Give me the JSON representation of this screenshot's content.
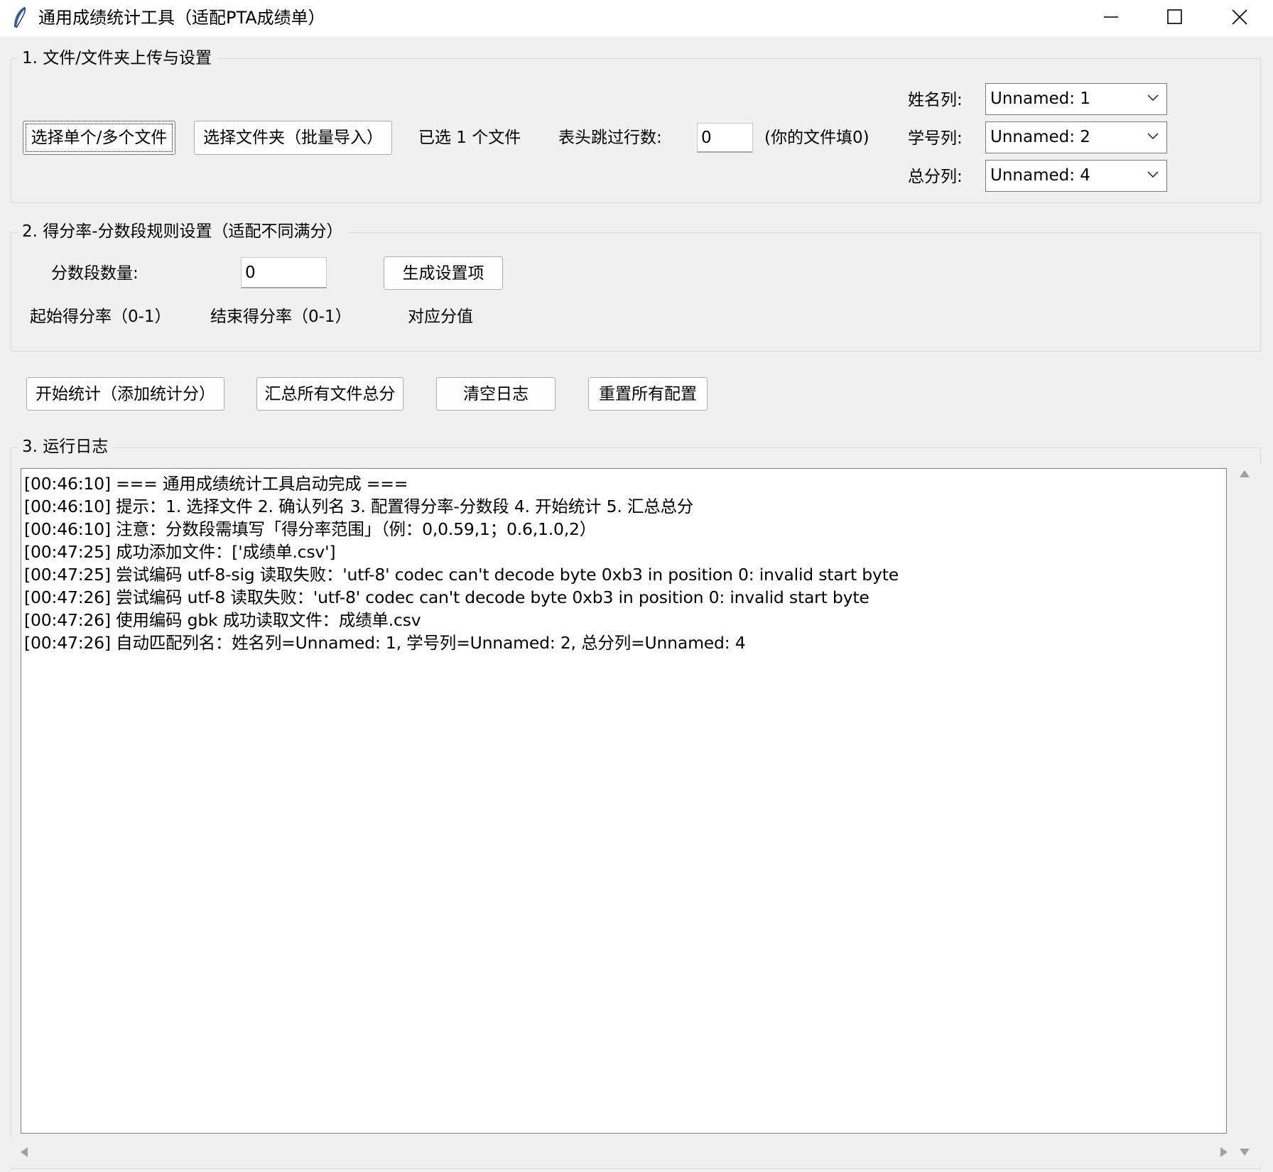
{
  "window": {
    "title": "通用成绩统计工具（适配PTA成绩单）"
  },
  "section1": {
    "label": "1. 文件/文件夹上传与设置",
    "select_files_button": "选择单个/多个文件",
    "select_folder_button": "选择文件夹（批量导入）",
    "selected_count_text": "已选 1 个文件",
    "skip_rows_label": "表头跳过行数:",
    "skip_rows_value": "0",
    "skip_rows_hint": "(你的文件填0)",
    "name_col_label": "姓名列:",
    "name_col_value": "Unnamed: 1",
    "id_col_label": "学号列:",
    "id_col_value": "Unnamed: 2",
    "total_col_label": "总分列:",
    "total_col_value": "Unnamed: 4"
  },
  "section2": {
    "label": "2. 得分率-分数段规则设置（适配不同满分）",
    "segment_count_label": "分数段数量:",
    "segment_count_value": "0",
    "generate_button": "生成设置项",
    "col_start": "起始得分率（0-1）",
    "col_end": "结束得分率（0-1）",
    "col_score": "对应分值"
  },
  "actions": {
    "start_button": "开始统计（添加统计分）",
    "summary_button": "汇总所有文件总分",
    "clear_log_button": "清空日志",
    "reset_button": "重置所有配置"
  },
  "section3": {
    "label": "3. 运行日志",
    "lines": [
      "[00:46:10] === 通用成绩统计工具启动完成 ===",
      "[00:46:10] 提示：1. 选择文件 2. 确认列名 3. 配置得分率-分数段 4. 开始统计 5. 汇总总分",
      "[00:46:10] 注意：分数段需填写「得分率范围」（例：0,0.59,1；0.6,1.0,2）",
      "[00:47:25] 成功添加文件：['成绩单.csv']",
      "[00:47:25] 尝试编码 utf-8-sig 读取失败：'utf-8' codec can't decode byte 0xb3 in position 0: invalid start byte",
      "[00:47:26] 尝试编码 utf-8 读取失败：'utf-8' codec can't decode byte 0xb3 in position 0: invalid start byte",
      "[00:47:26] 使用编码 gbk 成功读取文件：成绩单.csv",
      "[00:47:26] 自动匹配列名：姓名列=Unnamed: 1, 学号列=Unnamed: 2, 总分列=Unnamed: 4"
    ]
  }
}
